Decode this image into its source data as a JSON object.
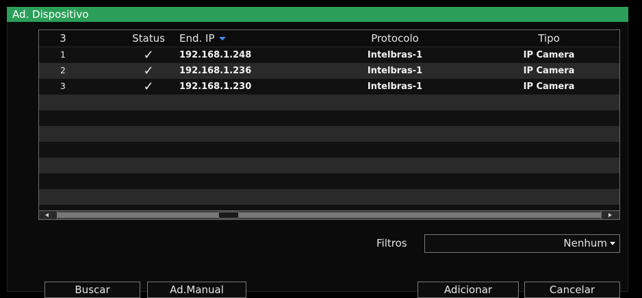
{
  "window": {
    "title": "Ad. Dispositivo"
  },
  "table": {
    "columns": [
      "3",
      "Status",
      "End. IP",
      "Protocolo",
      "Tipo"
    ],
    "sort_indicator": "sort-desc-icon",
    "rows": [
      {
        "num": "1",
        "status": "✓",
        "ip": "192.168.1.248",
        "protocolo": "Intelbras-1",
        "tipo": "IP Camera"
      },
      {
        "num": "2",
        "status": "✓",
        "ip": "192.168.1.236",
        "protocolo": "Intelbras-1",
        "tipo": "IP Camera"
      },
      {
        "num": "3",
        "status": "✓",
        "ip": "192.168.1.230",
        "protocolo": "Intelbras-1",
        "tipo": "IP Camera"
      }
    ]
  },
  "filters": {
    "label": "Filtros",
    "value": "Nenhum"
  },
  "buttons": {
    "buscar": "Buscar",
    "manual": "Ad.Manual",
    "adicionar": "Adicionar",
    "cancelar": "Cancelar"
  },
  "colors": {
    "titlebar": "#2b9f5a",
    "status_check": "#44c46a",
    "sort_arrow": "#3d8cff"
  }
}
